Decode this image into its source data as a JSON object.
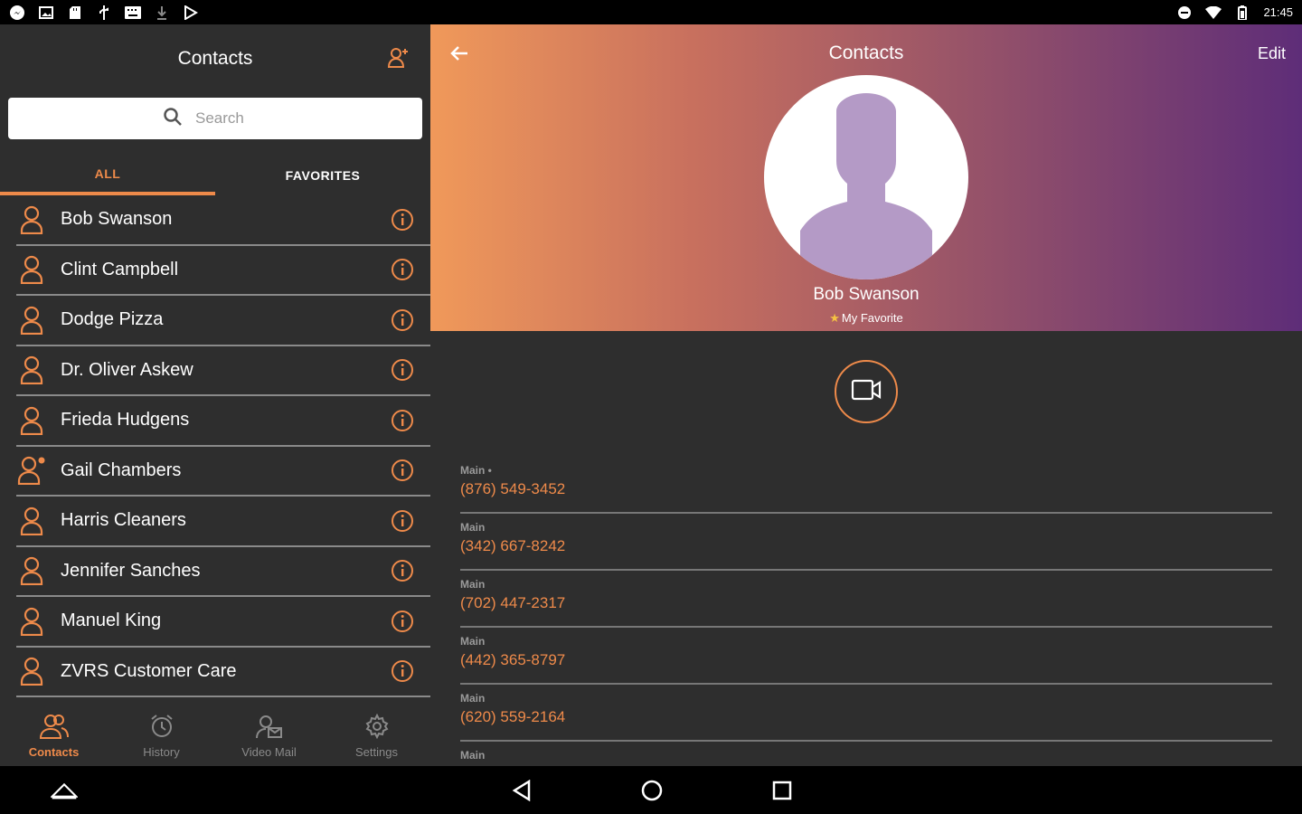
{
  "status_bar": {
    "time": "21:45",
    "left_icons": [
      "messenger-icon",
      "image-icon",
      "sd-card-icon",
      "usb-icon",
      "keyboard-icon",
      "download-icon",
      "play-store-icon"
    ],
    "right_icons": [
      "do-not-disturb-icon",
      "wifi-icon",
      "battery-icon"
    ]
  },
  "left_panel": {
    "title": "Contacts",
    "search": {
      "placeholder": "Search"
    },
    "tabs": [
      {
        "label": "ALL",
        "active": true
      },
      {
        "label": "FAVORITES",
        "active": false
      }
    ],
    "contacts": [
      {
        "name": "Bob Swanson",
        "icon": "person-icon"
      },
      {
        "name": "Clint Campbell",
        "icon": "person-icon"
      },
      {
        "name": "Dodge Pizza",
        "icon": "person-icon"
      },
      {
        "name": "Dr. Oliver Askew",
        "icon": "person-icon"
      },
      {
        "name": "Frieda Hudgens",
        "icon": "person-icon"
      },
      {
        "name": "Gail Chambers",
        "icon": "person-favorite-icon"
      },
      {
        "name": "Harris Cleaners",
        "icon": "person-icon"
      },
      {
        "name": "Jennifer Sanches",
        "icon": "person-icon"
      },
      {
        "name": "Manuel King",
        "icon": "person-icon"
      },
      {
        "name": "ZVRS Customer Care",
        "icon": "person-icon"
      }
    ],
    "bottom_nav": [
      {
        "label": "Contacts",
        "icon": "contacts-icon",
        "active": true
      },
      {
        "label": "History",
        "icon": "alarm-clock-icon",
        "active": false
      },
      {
        "label": "Video Mail",
        "icon": "video-mail-icon",
        "active": false
      },
      {
        "label": "Settings",
        "icon": "gear-icon",
        "active": false
      }
    ]
  },
  "detail": {
    "title": "Contacts",
    "edit_label": "Edit",
    "name": "Bob Swanson",
    "favorite_label": "My Favorite",
    "phones": [
      {
        "label": "Main •",
        "number": "(876) 549-3452"
      },
      {
        "label": "Main",
        "number": "(342) 667-8242"
      },
      {
        "label": "Main",
        "number": "(702) 447-2317"
      },
      {
        "label": "Main",
        "number": "(442) 365-8797"
      },
      {
        "label": "Main",
        "number": "(620) 559-2164"
      },
      {
        "label": "Main",
        "number": ""
      }
    ]
  },
  "colors": {
    "accent": "#ee8a4a",
    "panel_bg": "#2e2e2e",
    "gradient_start": "#f0995a",
    "gradient_end": "#5e2d78",
    "avatar_silhouette": "#b49ac6"
  }
}
